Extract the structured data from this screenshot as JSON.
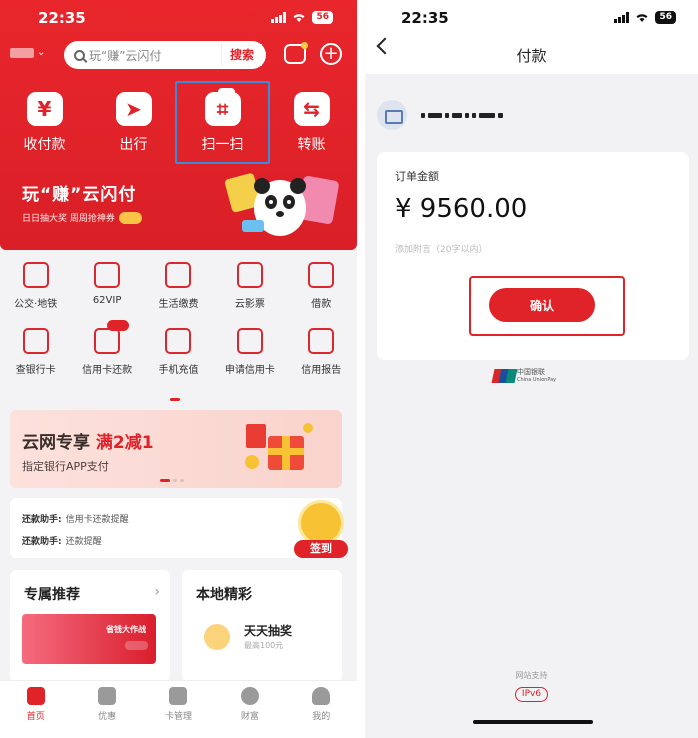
{
  "left": {
    "status_time": "22:35",
    "battery": "56",
    "search_placeholder": "玩“赚”云闪付",
    "search_button": "搜索",
    "quick_actions": [
      {
        "label": "收付款",
        "icon": "yuan-icon",
        "glyph": "¥"
      },
      {
        "label": "出行",
        "icon": "paper-plane-icon",
        "glyph": "➤"
      },
      {
        "label": "扫一扫",
        "icon": "scan-icon",
        "glyph": "⌗"
      },
      {
        "label": "转账",
        "icon": "transfer-icon",
        "glyph": "⇆"
      }
    ],
    "promo_title": "玩“赚”云闪付",
    "promo_sub": "日日抽大奖 周周抢神券",
    "services_row1": [
      {
        "label": "公交·地铁",
        "icon": "bus-icon"
      },
      {
        "label": "62VIP",
        "icon": "crown-icon"
      },
      {
        "label": "生活缴费",
        "icon": "flame-icon"
      },
      {
        "label": "云影票",
        "icon": "cloud-ticket-icon"
      },
      {
        "label": "借款",
        "icon": "money-bag-icon"
      }
    ],
    "services_row2": [
      {
        "label": "查银行卡",
        "icon": "bank-card-search-icon"
      },
      {
        "label": "信用卡还款",
        "icon": "credit-card-repay-icon"
      },
      {
        "label": "手机充值",
        "icon": "phone-topup-icon"
      },
      {
        "label": "申请信用卡",
        "icon": "apply-card-icon"
      },
      {
        "label": "信用报告",
        "icon": "credit-report-icon"
      }
    ],
    "banner_title_a": "云网专享",
    "banner_title_b": "满2减1",
    "banner_sub": "指定银行APP支付",
    "reminders": [
      {
        "key": "还款助手:",
        "value": "信用卡还款提醒"
      },
      {
        "key": "还款助手:",
        "value": "还款提醒"
      }
    ],
    "checkin_label": "签到",
    "recommend_title": "专属推荐",
    "recommend_tile": "省钱大作战",
    "local_title": "本地精彩",
    "lottery_title": "天天抽奖",
    "lottery_sub": "最高100元",
    "tabs": [
      {
        "label": "首页",
        "icon": "home-icon",
        "active": true
      },
      {
        "label": "优惠",
        "icon": "coupon-icon",
        "active": false
      },
      {
        "label": "卡管理",
        "icon": "card-icon",
        "active": false
      },
      {
        "label": "财富",
        "icon": "wealth-icon",
        "active": false
      },
      {
        "label": "我的",
        "icon": "profile-icon",
        "active": false
      }
    ]
  },
  "right": {
    "status_time": "22:35",
    "battery": "56",
    "title": "付款",
    "order_label": "订单金额",
    "amount": "¥ 9560.00",
    "note_placeholder": "添加附言（20字以内）",
    "confirm": "确认",
    "unionpay_cn": "中国银联",
    "unionpay_en": "China UnionPay",
    "ipv6_label": "网站支持",
    "ipv6_badge": "IPv6"
  },
  "colors": {
    "brand_red": "#e02229",
    "highlight_blue": "#3b8bdc"
  }
}
